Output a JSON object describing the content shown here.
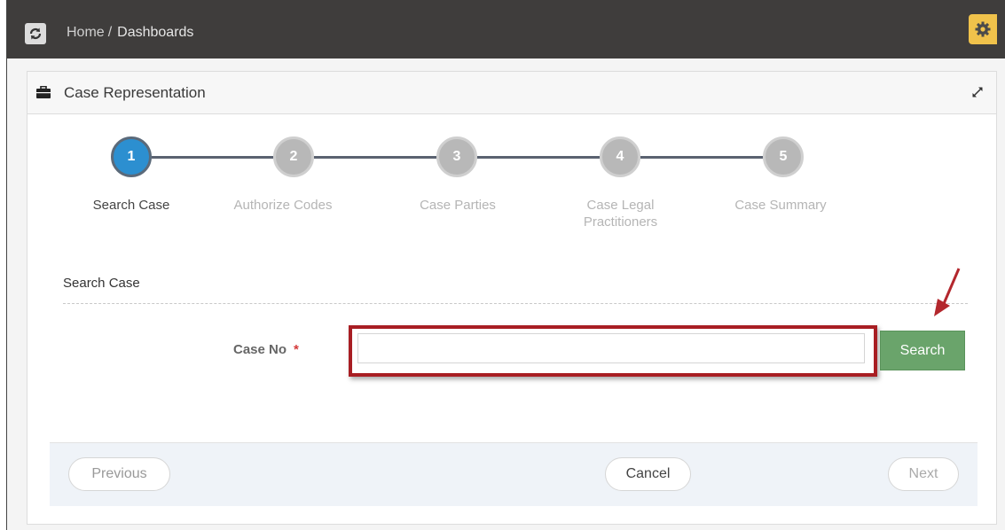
{
  "header": {
    "breadcrumb_home": "Home",
    "breadcrumb_sep": "/",
    "breadcrumb_current": "Dashboards"
  },
  "panel": {
    "title": "Case Representation"
  },
  "wizard": {
    "steps": [
      {
        "number": "1",
        "label": "Search Case",
        "active": true
      },
      {
        "number": "2",
        "label": "Authorize Codes",
        "active": false
      },
      {
        "number": "3",
        "label": "Case Parties",
        "active": false
      },
      {
        "number": "4",
        "label": "Case Legal Practitioners",
        "active": false
      },
      {
        "number": "5",
        "label": "Case Summary",
        "active": false
      }
    ]
  },
  "form": {
    "section_title": "Search Case",
    "case_no_label": "Case No",
    "required_mark": "*",
    "case_no_value": "",
    "search_label": "Search"
  },
  "footer": {
    "previous_label": "Previous",
    "cancel_label": "Cancel",
    "next_label": "Next"
  },
  "colors": {
    "topbar": "#3f3d3c",
    "active_step": "#2c8fd0",
    "inactive_step": "#b8b8b8",
    "search_button": "#6aa46b",
    "highlight_box": "#a81e23",
    "gear_button": "#f0c24b"
  },
  "icons": {
    "refresh": "refresh-icon",
    "gear": "gear-icon",
    "briefcase": "briefcase-icon",
    "expand": "expand-icon",
    "annotation_arrow": "arrow-icon"
  }
}
